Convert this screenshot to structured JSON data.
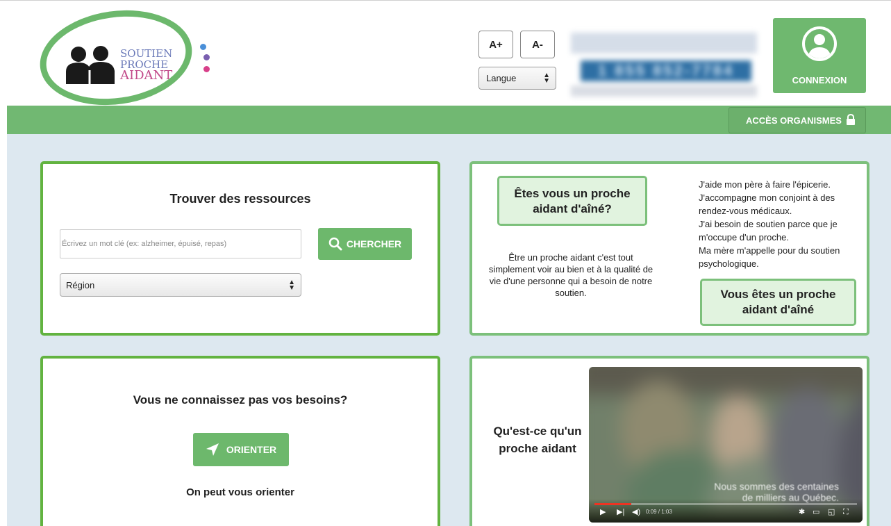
{
  "header": {
    "logo": {
      "line1": "SOUTIEN",
      "line2": "PROCHE",
      "line3": "AIDANT"
    },
    "font_increase": "A+",
    "font_decrease": "A-",
    "language_select": "Langue",
    "phone": "1 855 852-7784",
    "login_label": "CONNEXION"
  },
  "nav": {
    "acces_label": "ACCÈS ORGANISMES"
  },
  "search_panel": {
    "title": "Trouver des ressources",
    "search_placeholder": "Écrivez un mot clé (ex: alzheimer, épuisé, repas)",
    "search_button": "CHERCHER",
    "region_select": "Région"
  },
  "aidant_panel": {
    "question": "Êtes vous un proche aidant d'aîné?",
    "description": "Être un proche aidant c'est tout simplement voir au bien et à la qualité de vie d'une personne qui a besoin de notre soutien.",
    "examples": [
      "J'aide mon père à faire l'épicerie.",
      "J'accompagne mon conjoint à des rendez-vous médicaux.",
      "J'ai besoin de soutien parce que je m'occupe d'un proche.",
      "Ma mère m'appelle pour du soutien psychologique."
    ],
    "answer_button": "Vous êtes un proche aidant d'aîné"
  },
  "orient_panel": {
    "title": "Vous ne connaissez pas vos besoins?",
    "button": "ORIENTER",
    "subtitle": "On peut vous orienter"
  },
  "video_panel": {
    "label": "Qu'est-ce qu'un proche aidant",
    "caption_line1": "Nous sommes des centaines",
    "caption_line2": "de milliers au Québec.",
    "time": "0:09 / 1:03",
    "progress": 0.14
  },
  "colors": {
    "brand_green": "#6db86c",
    "nav_green": "#71b872",
    "background": "#dde8f0",
    "phone_blue": "#2e6fa4"
  }
}
